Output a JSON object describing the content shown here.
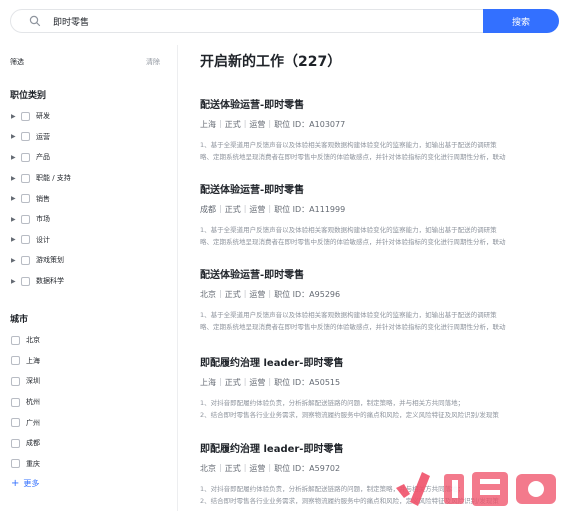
{
  "search": {
    "value": "即时零售",
    "button_label": "搜索"
  },
  "sidebar": {
    "filter_label": "筛选",
    "clear_label": "清除",
    "category_title": "职位类别",
    "categories": [
      "研发",
      "运营",
      "产品",
      "职能 / 支持",
      "销售",
      "市场",
      "设计",
      "游戏策划",
      "数据科学"
    ],
    "city_title": "城市",
    "cities": [
      "北京",
      "上海",
      "深圳",
      "杭州",
      "广州",
      "成都",
      "重庆"
    ],
    "more_label": "更多"
  },
  "main": {
    "title": "开启新的工作（227）",
    "jobs": [
      {
        "title": "配送体验运营-即时零售",
        "city": "上海",
        "type": "正式",
        "category": "运营",
        "job_id": "职位 ID：A103077",
        "desc1": "1、基于全渠道用户反馈声音以及体验相关客观数据构建体验变化的监察能力，如输出基于配送的调研策",
        "desc2": "略、定期系统地呈现消费者在即时零售中反馈的体验敏感点，并针对体验指标的变化进行周期性分析，联动"
      },
      {
        "title": "配送体验运营-即时零售",
        "city": "成都",
        "type": "正式",
        "category": "运营",
        "job_id": "职位 ID：A111999",
        "desc1": "1、基于全渠道用户反馈声音以及体验相关客观数据构建体验变化的监察能力，如输出基于配送的调研策",
        "desc2": "略、定期系统地呈现消费者在即时零售中反馈的体验敏感点，并针对体验指标的变化进行周期性分析，联动"
      },
      {
        "title": "配送体验运营-即时零售",
        "city": "北京",
        "type": "正式",
        "category": "运营",
        "job_id": "职位 ID：A95296",
        "desc1": "1、基于全渠道用户反馈声音以及体验相关客观数据构建体验变化的监察能力，如输出基于配送的调研策",
        "desc2": "略、定期系统地呈现消费者在即时零售中反馈的体验敏感点，并针对体验指标的变化进行周期性分析，联动"
      },
      {
        "title": "即配履约治理 leader-即时零售",
        "city": "上海",
        "type": "正式",
        "category": "运营",
        "job_id": "职位 ID：A50515",
        "desc1": "1、对抖音即配履约体验负责，分析拆解配送链路的问题，制定策略，并与相关方共同落地；",
        "desc2": "2、结合即时零售各行业业务需求，洞察物流履约服务中的痛点和风险，定义风险特征及风险识别/发现策"
      },
      {
        "title": "即配履约治理 leader-即时零售",
        "city": "北京",
        "type": "正式",
        "category": "运营",
        "job_id": "职位 ID：A59702",
        "desc1": "1、对抖音即配履约体验负责，分析拆解配送链路的问题，制定策略，并与相关方共同落地；",
        "desc2": "2、结合即时零售各行业业务需求，洞察物流履约服务中的痛点和风险，定义风险特征及风险识别/发现策"
      }
    ]
  },
  "colors": {
    "accent": "#3370ff",
    "logo_red": "#f0526a"
  }
}
